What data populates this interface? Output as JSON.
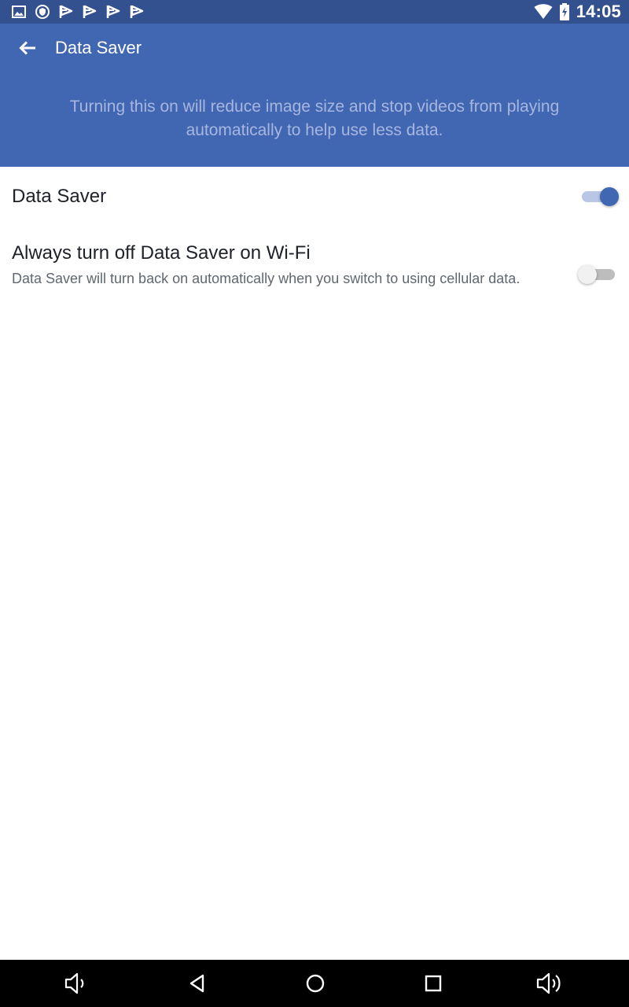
{
  "status_bar": {
    "time": "14:05",
    "left_icons": [
      "image-icon",
      "shield-icon",
      "flag-icon",
      "flag-icon",
      "flag-icon",
      "flag-icon"
    ],
    "right_icons": [
      "wifi-icon",
      "battery-charging-icon"
    ]
  },
  "app_bar": {
    "title": "Data Saver",
    "description": "Turning this on will reduce image size and stop videos from playing automatically to help use less data.",
    "back_icon": "back-arrow-icon"
  },
  "settings": [
    {
      "title": "Data Saver",
      "enabled": true
    },
    {
      "title": "Always turn off Data Saver on Wi-Fi",
      "description": "Data Saver will turn back on automatically when you switch to using cellular data.",
      "enabled": false
    }
  ],
  "nav_bar": {
    "buttons": [
      "volume-down-icon",
      "back-triangle-icon",
      "home-circle-icon",
      "recents-square-icon",
      "volume-up-icon"
    ]
  },
  "colors": {
    "status_bar": "#33508f",
    "app_bar": "#4267b2",
    "description_text": "#a7b6e0",
    "toggle_on_thumb": "#4267b2",
    "toggle_on_track": "#b9c6e5",
    "toggle_off_thumb": "#f1f1f1",
    "toggle_off_track": "#bdbdbd",
    "title_text": "#1d2129",
    "secondary_text": "#606770"
  }
}
